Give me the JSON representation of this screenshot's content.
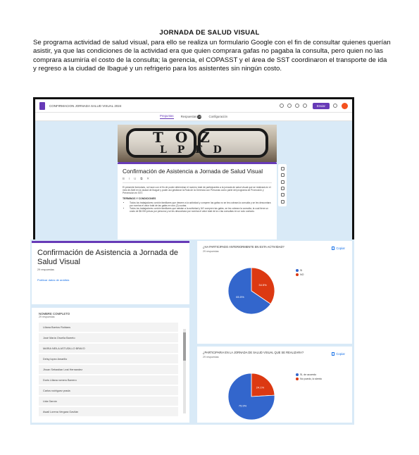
{
  "doc": {
    "title": "JORNADA DE SALUD VISUAL",
    "paragraph": "Se programa actividad de salud visual, para ello se realiza un formulario Google con el fin de consultar quienes querían asistir, ya que las condiciones de la actividad era que quien comprara gafas no pagaba la consulta, pero quien no las comprara asumiría el costo de la consulta; la gerencia, el COPASST y el área de SST coordinaron el transporte de ida y regreso a la ciudad de Ibagué y un refrigerio para los asistentes sin ningún costo."
  },
  "editor": {
    "doc_title": "CONFIRMACION JORNADA SALUD VISUAL 2024",
    "send_label": "Enviar",
    "tabs": [
      "Preguntas",
      "Respuestas",
      "Configuración"
    ],
    "responses_badge": "29",
    "banner_row1": "T O Z",
    "banner_row2": "L P E D",
    "form_title": "Confirmación de Asistencia a Jornada de Salud Visual",
    "format_tools": [
      "B",
      "I",
      "U",
      "⧉",
      "✕"
    ],
    "description": "El presente formulario, se hace con el fin de poder determinar el numero total de participantes a la jornada de salud visual que se realizará en el mes de Abril en la ciudad de Ibagué y poder así gestionar la Ruta de la Gerencia con Personas como parte del programa de Promoción y Prevención en SST.",
    "terms_title": "TERMINOS Y CONDICIONES",
    "bullets": [
      "Todos los trabajadores con/sin familiares que deseen a la actividad y compren las gafas no se les cobrara la consulta y se les descontara por nomina el valor total de las gafas en dos (2) cuotas.",
      "Todos los trabajadores con/sin familiares que asistan a la actividad y NO compren las gafas, se les cobrara la consulta, la cual tiene un costo de $6.000 pesos por persona y se les descontara por nomina el valor total de la o las consultas en un solo contado."
    ]
  },
  "responses": {
    "form_title": "Confirmación de Asistencia a Jornada de Salud Visual",
    "count_label": "29 respuestas",
    "publish_label": "Publicar datos de análisis",
    "list_header": "NOMBRE COMPLETO",
    "list_count": "29 respuestas",
    "names": [
      "Liliana Barrios Roldans",
      "José María Oruella Barreto",
      "MARIA NEILA ASTUDILLO BRAVO",
      "Delsy lopez Amarillo",
      "Jhoan Sebastian Leal Hernandez",
      "Doris Liliana romero Barrero",
      "Carlos rodriguez prada",
      "Lida García",
      "Awail Lorena Vergara Gavilán"
    ],
    "copy_label": "Copiar"
  },
  "chart_data": [
    {
      "type": "pie",
      "title": "¿HA PARTICIPADO ANTERIORMENTE EN ESTA ACTIVIDAD?",
      "count_label": "29 respuestas",
      "categories": [
        "Si",
        "NO"
      ],
      "values": [
        65.5,
        34.5
      ],
      "labels": [
        "65.5%",
        "34.5%"
      ],
      "colors": [
        "#3366cc",
        "#dc3912"
      ],
      "legend": "right"
    },
    {
      "type": "pie",
      "title": "¿PARTICIPARIA EN LA JORNADA DE SALUD VISUAL QUE SE REALIZARA?",
      "count_label": "29 respuestas",
      "categories": [
        "Si, de acuerdo",
        "No puedo, lo siento"
      ],
      "values": [
        75.9,
        24.1
      ],
      "labels": [
        "75.9%",
        "24.1%"
      ],
      "colors": [
        "#3366cc",
        "#dc3912"
      ],
      "legend": "right"
    }
  ]
}
